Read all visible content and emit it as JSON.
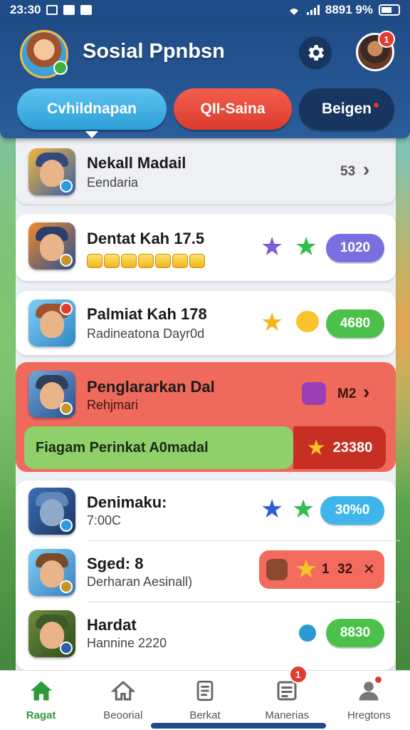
{
  "status_bar": {
    "time": "23:30",
    "battery_text": "8891 9%"
  },
  "header": {
    "title": "Sosial Ppnbsn",
    "profile_notification_count": "1"
  },
  "tabs": [
    {
      "label": "Cvhildnapan"
    },
    {
      "label": "QII-Saina"
    },
    {
      "label": "Beigen"
    }
  ],
  "rows": [
    {
      "title": "Nekall Madail",
      "subtitle": "Eendaria",
      "meta": "53"
    },
    {
      "title": "Dentat Kah 17.5",
      "pill": "1020"
    },
    {
      "title": "Palmiat Kah 178",
      "subtitle": "Radineatona Dayr0d",
      "pill": "4680"
    },
    {
      "title": "Denimaku:",
      "subtitle": "7:00C",
      "pill": "30%0"
    },
    {
      "title": "Sged: 8",
      "subtitle": "Derharan Aesinall)",
      "counter": "1",
      "score": "32",
      "close": "✕"
    },
    {
      "title": "Hardat",
      "subtitle": "Hannine 2220",
      "pill": "8830"
    }
  ],
  "highlight": {
    "title": "Penglararkan Dal",
    "subtitle": "Rehjmari",
    "meta": "M2",
    "banner": "Fiagam Perinkat A0madal",
    "score": "23380"
  },
  "bottom_nav": [
    {
      "label": "Ragat",
      "icon": "home-icon"
    },
    {
      "label": "Beoorial",
      "icon": "house-outline-icon"
    },
    {
      "label": "Berkat",
      "icon": "document-icon"
    },
    {
      "label": "Manerias",
      "icon": "inbox-icon",
      "badge": "1"
    },
    {
      "label": "Hregtons",
      "icon": "person-icon"
    }
  ],
  "colors": {
    "header": "#1f4c86",
    "tab_active": "#2c9fd8",
    "tab_red": "#dc3b2e",
    "highlight": "#ef6a5c",
    "pill_purple": "#7a6fe0",
    "pill_green": "#4cc14a",
    "pill_blue": "#3fb5ec",
    "nav_active": "#2e9b3a"
  }
}
